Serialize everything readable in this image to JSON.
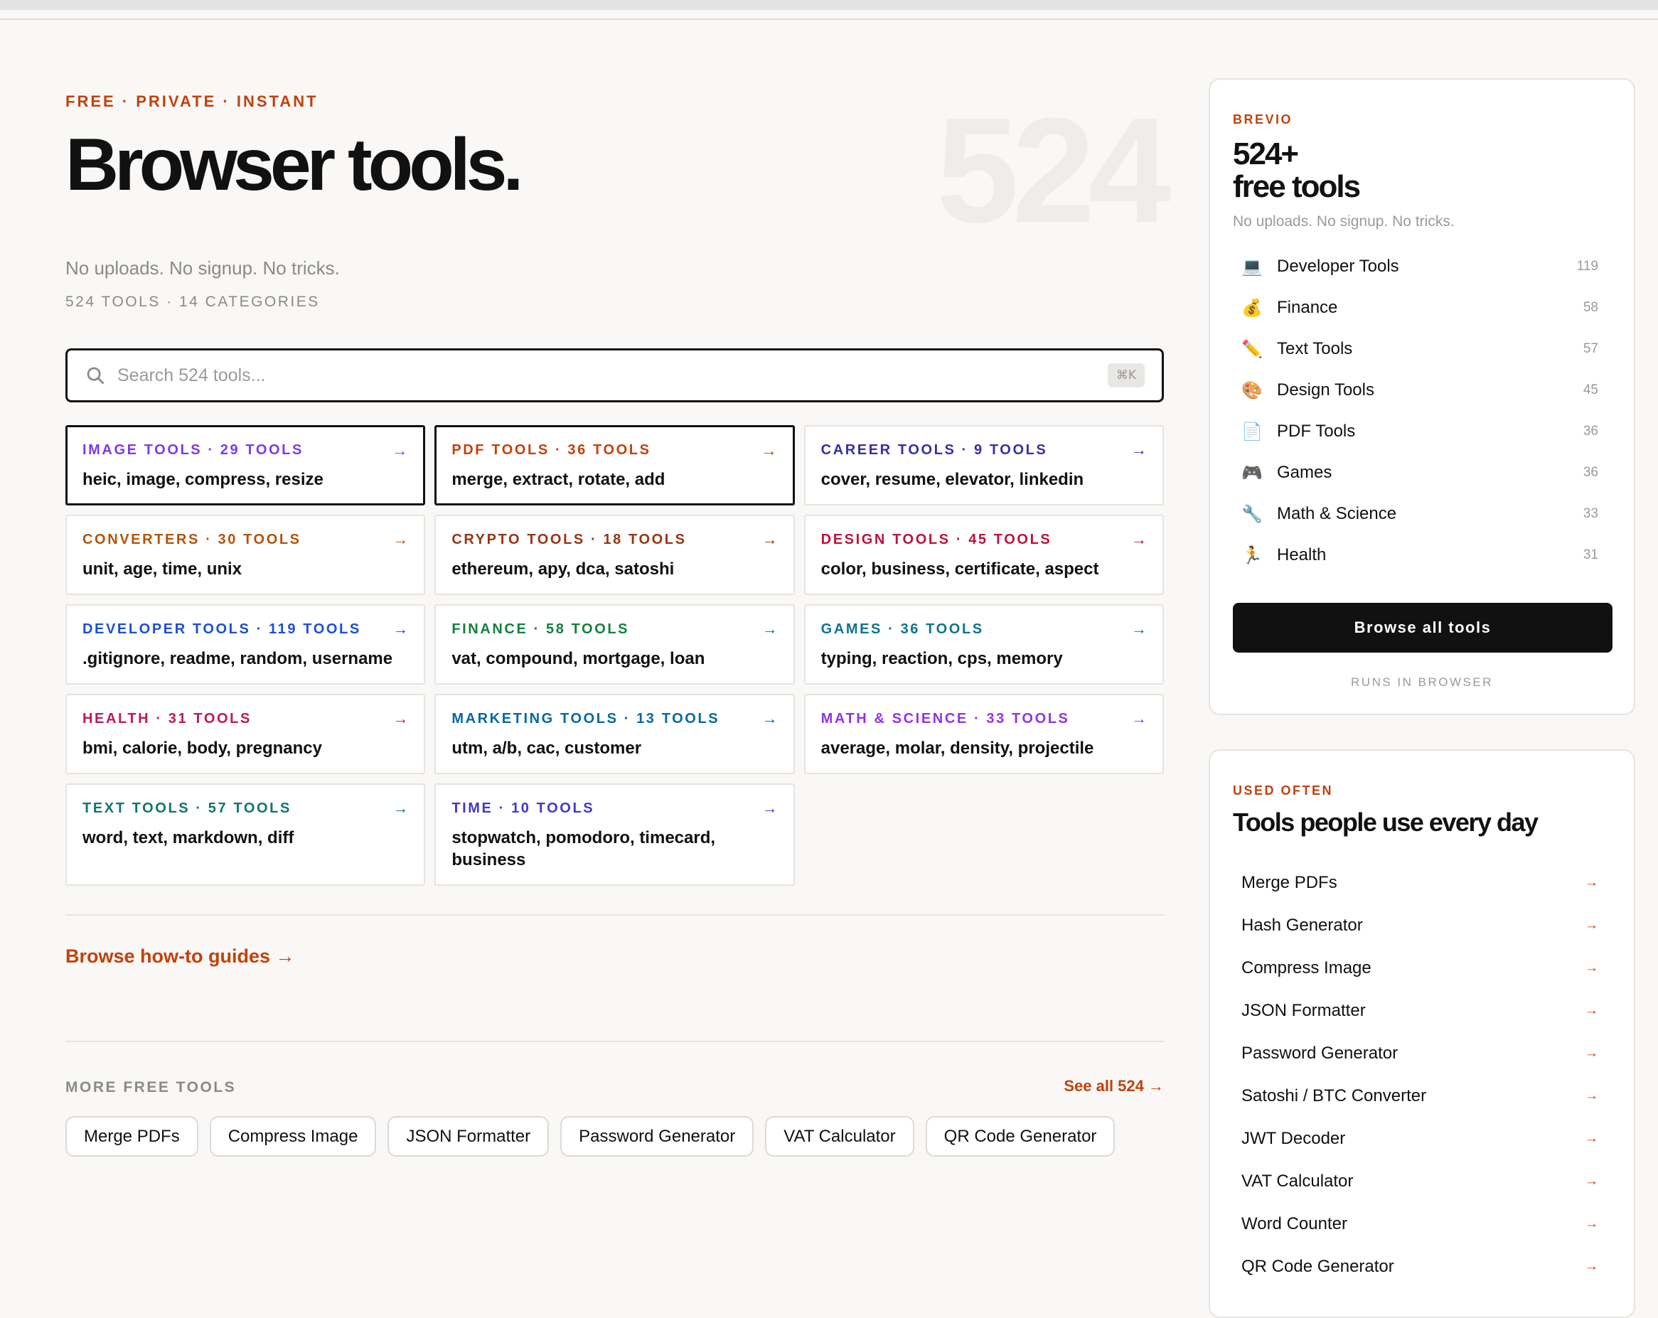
{
  "hero": {
    "eyebrow": "FREE · PRIVATE · INSTANT",
    "title": "Browser tools.",
    "ghost_number": "524",
    "subtitle": "No uploads. No signup. No tricks.",
    "meta": "524 TOOLS · 14 CATEGORIES"
  },
  "search": {
    "placeholder": "Search 524 tools...",
    "value": "",
    "shortcut": "⌘K",
    "icon": "search-icon"
  },
  "categories": [
    {
      "head": "IMAGE TOOLS · 29 TOOLS",
      "keywords": "heic, image, compress, resize",
      "color": "#7c3aed",
      "active": true
    },
    {
      "head": "PDF TOOLS · 36 TOOLS",
      "keywords": "merge, extract, rotate, add",
      "color": "#c2410c",
      "active": true
    },
    {
      "head": "CAREER TOOLS · 9 TOOLS",
      "keywords": "cover, resume, elevator, linkedin",
      "color": "#3730a3",
      "active": false
    },
    {
      "head": "CONVERTERS · 30 TOOLS",
      "keywords": "unit, age, time, unix",
      "color": "#b45309",
      "active": false
    },
    {
      "head": "CRYPTO TOOLS · 18 TOOLS",
      "keywords": "ethereum, apy, dca, satoshi",
      "color": "#9a3412",
      "active": false
    },
    {
      "head": "DESIGN TOOLS · 45 TOOLS",
      "keywords": "color, business, certificate, aspect",
      "color": "#be123c",
      "active": false
    },
    {
      "head": "DEVELOPER TOOLS · 119 TOOLS",
      "keywords": ".gitignore, readme, random, username",
      "color": "#1d4ed8",
      "active": false
    },
    {
      "head": "FINANCE · 58 TOOLS",
      "keywords": "vat, compound, mortgage, loan",
      "color": "#15803d",
      "active": false
    },
    {
      "head": "GAMES · 36 TOOLS",
      "keywords": "typing, reaction, cps, memory",
      "color": "#0e7490",
      "active": false
    },
    {
      "head": "HEALTH · 31 TOOLS",
      "keywords": "bmi, calorie, body, pregnancy",
      "color": "#be185d",
      "active": false
    },
    {
      "head": "MARKETING TOOLS · 13 TOOLS",
      "keywords": "utm, a/b, cac, customer",
      "color": "#0369a1",
      "active": false
    },
    {
      "head": "MATH & SCIENCE · 33 TOOLS",
      "keywords": "average, molar, density, projectile",
      "color": "#9333ea",
      "active": false
    },
    {
      "head": "TEXT TOOLS · 57 TOOLS",
      "keywords": "word, text, markdown, diff",
      "color": "#0f766e",
      "active": false
    },
    {
      "head": "TIME · 10 TOOLS",
      "keywords": "stopwatch, pomodoro, timecard, business",
      "color": "#4338ca",
      "active": false
    }
  ],
  "card_arrow": "→",
  "guides_link": "Browse how-to guides →",
  "more": {
    "label": "MORE FREE TOOLS",
    "see_all": "See all 524 →",
    "pills": [
      "Merge PDFs",
      "Compress Image",
      "JSON Formatter",
      "Password Generator",
      "VAT Calculator",
      "QR Code Generator"
    ]
  },
  "sidebar": {
    "eyebrow": "BREVIO",
    "title_line1": "524+",
    "title_line2": "free tools",
    "subtitle": "No uploads. No signup. No tricks.",
    "categories": [
      {
        "emoji": "💻",
        "label": "Developer Tools",
        "count": "119"
      },
      {
        "emoji": "💰",
        "label": "Finance",
        "count": "58"
      },
      {
        "emoji": "✏️",
        "label": "Text Tools",
        "count": "57"
      },
      {
        "emoji": "🎨",
        "label": "Design Tools",
        "count": "45"
      },
      {
        "emoji": "📄",
        "label": "PDF Tools",
        "count": "36"
      },
      {
        "emoji": "🎮",
        "label": "Games",
        "count": "36"
      },
      {
        "emoji": "🔧",
        "label": "Math & Science",
        "count": "33"
      },
      {
        "emoji": "🏃",
        "label": "Health",
        "count": "31"
      }
    ],
    "browse_button": "Browse all tools",
    "runs_note": "RUNS IN BROWSER"
  },
  "popular": {
    "eyebrow": "USED OFTEN",
    "title": "Tools people use every day",
    "arrow": "→",
    "items": [
      "Merge PDFs",
      "Hash Generator",
      "Compress Image",
      "JSON Formatter",
      "Password Generator",
      "Satoshi / BTC Converter",
      "JWT Decoder",
      "VAT Calculator",
      "Word Counter",
      "QR Code Generator"
    ]
  },
  "colors": {
    "accent": "#c2410c",
    "ink": "#111111",
    "muted": "#8a8a8a",
    "background": "#f9f8f6"
  }
}
